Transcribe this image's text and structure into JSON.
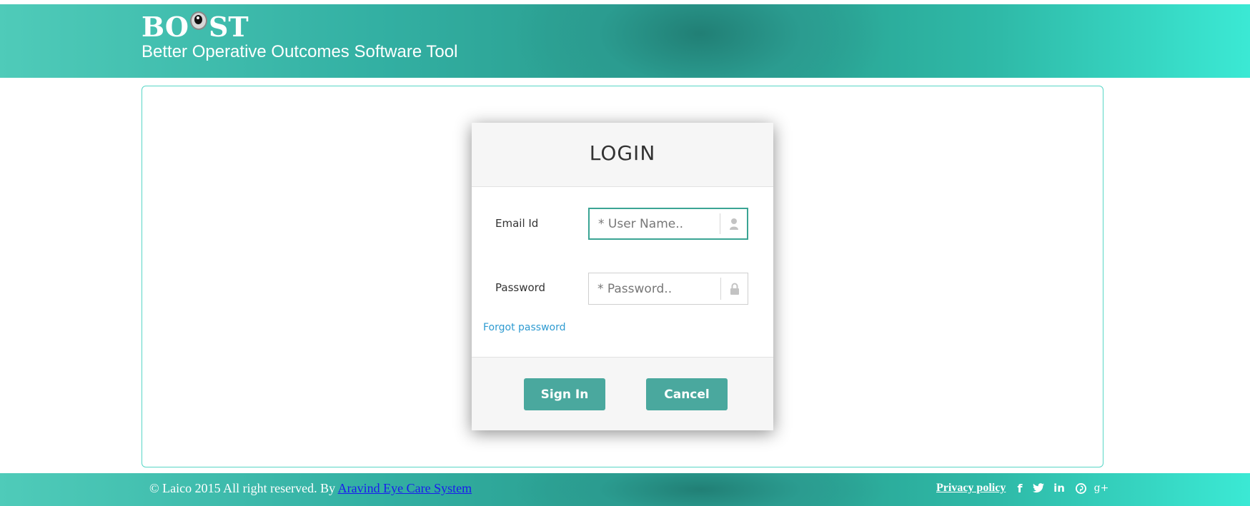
{
  "header": {
    "logo_part1": "BO",
    "logo_part2": "ST",
    "tagline": "Better Operative Outcomes Software Tool"
  },
  "login": {
    "title": "LOGIN",
    "email_label": "Email Id",
    "email_placeholder": "* User Name..",
    "email_value": "",
    "email_icon": "user-icon",
    "password_label": "Password",
    "password_placeholder": "* Password..",
    "password_value": "",
    "password_icon": "lock-icon",
    "forgot_label": "Forgot password",
    "signin_label": "Sign In",
    "cancel_label": "Cancel"
  },
  "footer": {
    "copyright_text": "© Laico 2015 All right reserved. By",
    "company_link": "Aravind Eye Care System",
    "privacy_label": "Privacy policy",
    "social": [
      "f",
      "in",
      "g+"
    ],
    "social_icons": [
      "facebook-icon",
      "twitter-icon",
      "linkedin-icon",
      "pinterest-icon",
      "google-plus-icon"
    ]
  },
  "colors": {
    "accent": "#4aa89e",
    "header_mid": "#279889",
    "header_end": "#3be9d4",
    "link": "#2f9bd1",
    "frame_border": "#57d6c6"
  }
}
